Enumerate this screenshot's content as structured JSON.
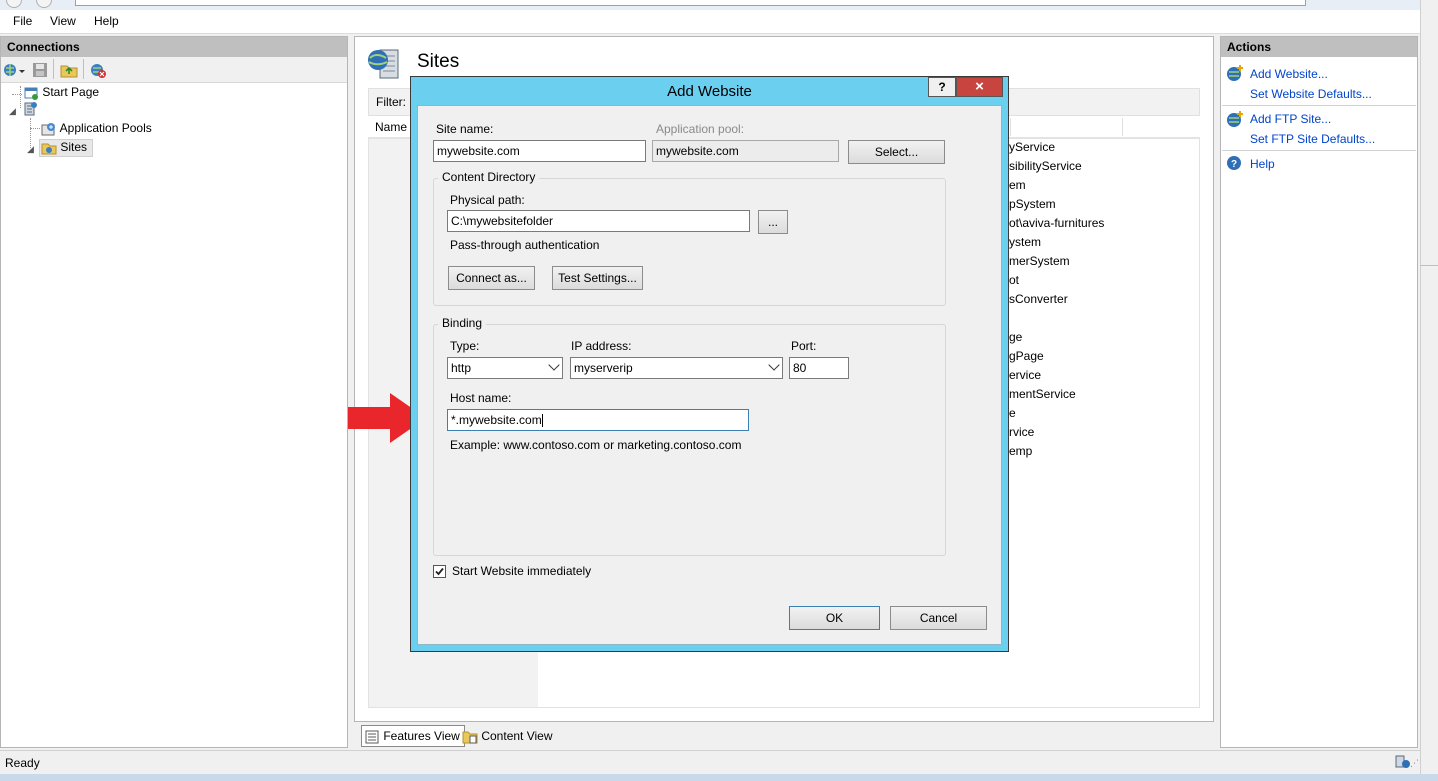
{
  "menu": {
    "file": "File",
    "view": "View",
    "help": "Help"
  },
  "connections": {
    "header": "Connections",
    "tree": {
      "start_page": "Start Page",
      "server": "",
      "app_pools": "Application Pools",
      "sites": "Sites"
    }
  },
  "center": {
    "title": "Sites",
    "filter_label": "Filter:",
    "name_col": "Name",
    "list_fragments": [
      "yService",
      "sibilityService",
      "em",
      "pSystem",
      "ot\\aviva-furnitures",
      "ystem",
      "merSystem",
      "ot",
      "sConverter",
      "",
      "ge",
      "gPage",
      "ervice",
      "mentService",
      "e",
      "rvice",
      "emp"
    ],
    "features_view": "Features View",
    "content_view": "Content View"
  },
  "actions": {
    "header": "Actions",
    "add_website": "Add Website...",
    "set_website_defaults": "Set Website Defaults...",
    "add_ftp_site": "Add FTP Site...",
    "set_ftp_defaults": "Set FTP Site Defaults...",
    "help": "Help"
  },
  "status": {
    "text": "Ready"
  },
  "dialog": {
    "title": "Add Website",
    "help_btn": "?",
    "close_btn": "×",
    "site_name_label": "Site name:",
    "site_name_value": "mywebsite.com",
    "app_pool_label": "Application pool:",
    "app_pool_value": "mywebsite.com",
    "select_btn": "Select...",
    "content_dir_title": "Content Directory",
    "physical_path_label": "Physical path:",
    "physical_path_value": "C:\\mywebsitefolder",
    "browse_btn": "...",
    "passthrough_label": "Pass-through authentication",
    "connect_as_btn": "Connect as...",
    "test_settings_btn": "Test Settings...",
    "binding_title": "Binding",
    "type_label": "Type:",
    "type_value": "http",
    "ip_label": "IP address:",
    "ip_value": "myserverip",
    "port_label": "Port:",
    "port_value": "80",
    "host_label": "Host name:",
    "host_value": "*.mywebsite.com",
    "example_text": "Example: www.contoso.com or marketing.contoso.com",
    "start_immediately": "Start Website immediately",
    "start_checked": true,
    "ok_btn": "OK",
    "cancel_btn": "Cancel"
  },
  "colors": {
    "dialog_frame": "#6bcfef",
    "close_button": "#c7443f",
    "arrow": "#e8262b",
    "link": "#0044cc"
  }
}
